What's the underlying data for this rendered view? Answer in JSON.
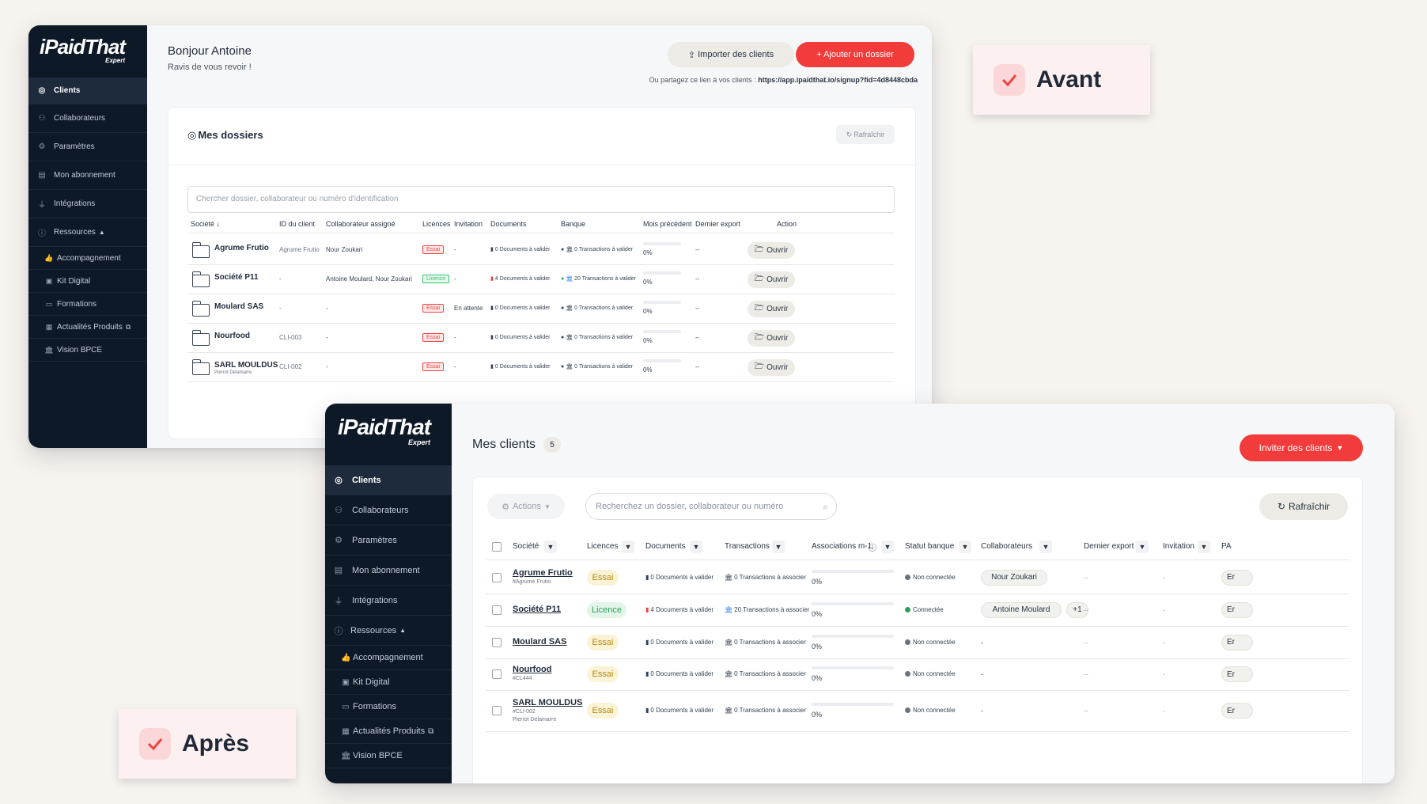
{
  "colors": {
    "primary": "#f23b3b",
    "sidebar": "#0e1928",
    "accent_green": "#2f9e5c",
    "essai": "#b48a14"
  },
  "labels": {
    "avant": "Avant",
    "apres": "Après"
  },
  "nav": {
    "clients": "Clients",
    "collaborateurs": "Collaborateurs",
    "parametres": "Paramètres",
    "abonnement": "Mon abonnement",
    "integrations": "Intégrations",
    "ressources": "Ressources",
    "sub": [
      "Accompagnement",
      "Kit Digital",
      "Formations",
      "Actualités Produits",
      "Vision BPCE"
    ]
  },
  "logo": {
    "main": "iPaidThat",
    "sub": "Expert"
  },
  "old": {
    "greeting": "Bonjour Antoine",
    "subgreeting": "Ravis de vous revoir !",
    "import_btn": "Importer des clients",
    "add_btn": "+ Ajouter un dossier",
    "share_text": "Ou partagez ce lien à vos clients : ",
    "share_link": "https://app.ipaidthat.io/signup?fid=4d8448cbda",
    "card_title": "Mes dossiers",
    "refresh": "Rafraîchir",
    "search_placeholder": "Chercher dossier, collaborateur ou numéro d'identification",
    "headers": [
      "Société ↓",
      "ID du client",
      "Collaborateur assigné",
      "Licences",
      "Invitation",
      "Documents",
      "Banque",
      "Mois précédent",
      "Dernier export",
      "Action"
    ],
    "rows": [
      {
        "name": "Agrume Frutio",
        "sub": "",
        "id": "Agrume Frutio",
        "collab": "Nour Zoukari",
        "lic": "Essai",
        "inv": "-",
        "docs": "0 Documents à valider",
        "bank": "0 Transactions à valider",
        "pct": "0%",
        "export": "--",
        "action": "Ouvrir"
      },
      {
        "name": "Société P11",
        "sub": "",
        "id": "-",
        "collab": "Antoine Moulard, Nour Zoukari",
        "lic": "Licence",
        "inv": "-",
        "docs": "4 Documents à valider",
        "bank": "20 Transactions à valider",
        "pct": "0%",
        "export": "--",
        "action": "Ouvrir"
      },
      {
        "name": "Moulard SAS",
        "sub": "",
        "id": "-",
        "collab": "-",
        "lic": "Essai",
        "inv": "En attente",
        "docs": "0 Documents à valider",
        "bank": "0 Transactions à valider",
        "pct": "0%",
        "export": "--",
        "action": "Ouvrir"
      },
      {
        "name": "Nourfood",
        "sub": "",
        "id": "CLI-003",
        "collab": "-",
        "lic": "Essai",
        "inv": "-",
        "docs": "0 Documents à valider",
        "bank": "0 Transactions à valider",
        "pct": "0%",
        "export": "--",
        "action": "Ouvrir"
      },
      {
        "name": "SARL MOULDUS",
        "sub": "Pierrot Delamarre",
        "id": "CLI-002",
        "collab": "-",
        "lic": "Essai",
        "inv": "-",
        "docs": "0 Documents à valider",
        "bank": "0 Transactions à valider",
        "pct": "0%",
        "export": "--",
        "action": "Ouvrir"
      }
    ]
  },
  "new": {
    "title": "Mes clients",
    "count": "5",
    "invite_btn": "Inviter des clients",
    "actions": "Actions",
    "search_placeholder": "Recherchez un dossier, collaborateur ou numéro",
    "refresh": "Rafraîchir",
    "headers": [
      "Société",
      "Licences",
      "Documents",
      "Transactions",
      "Associations m-1",
      "Statut banque",
      "Collaborateurs",
      "Dernier export",
      "Invitation",
      "PA"
    ],
    "rows": [
      {
        "name": "Agrume Frutio",
        "sub1": "#Agrume Frutio",
        "sub2": "",
        "lic": "Essai",
        "docs": "0 Documents à valider",
        "trans": "0 Transactions à associer",
        "pct": "0%",
        "bank": "Non connectée",
        "collab": "Nour Zoukari",
        "extra": "",
        "export": "--",
        "inv": "-",
        "pa": "Er"
      },
      {
        "name": "Société P11",
        "sub1": "",
        "sub2": "",
        "lic": "Licence",
        "docs": "4 Documents à valider",
        "trans": "20 Transactions à associer",
        "pct": "0%",
        "bank": "Connectée",
        "collab": "Antoine Moulard",
        "extra": "+1",
        "export": "--",
        "inv": "-",
        "pa": "Er"
      },
      {
        "name": "Moulard SAS",
        "sub1": "",
        "sub2": "",
        "lic": "Essai",
        "docs": "0 Documents à valider",
        "trans": "0 Transactions à associer",
        "pct": "0%",
        "bank": "Non connectée",
        "collab": "-",
        "extra": "",
        "export": "--",
        "inv": "-",
        "pa": "Er"
      },
      {
        "name": "Nourfood",
        "sub1": "#CL444",
        "sub2": "",
        "lic": "Essai",
        "docs": "0 Documents à valider",
        "trans": "0 Transactions à associer",
        "pct": "0%",
        "bank": "Non connectée",
        "collab": "-",
        "extra": "",
        "export": "--",
        "inv": "-",
        "pa": "Er"
      },
      {
        "name": "SARL MOULDUS",
        "sub1": "#CLI-002",
        "sub2": "Pierrot Delamarre",
        "lic": "Essai",
        "docs": "0 Documents à valider",
        "trans": "0 Transactions à associer",
        "pct": "0%",
        "bank": "Non connectée",
        "collab": "-",
        "extra": "",
        "export": "--",
        "inv": "-",
        "pa": "Er"
      }
    ]
  }
}
